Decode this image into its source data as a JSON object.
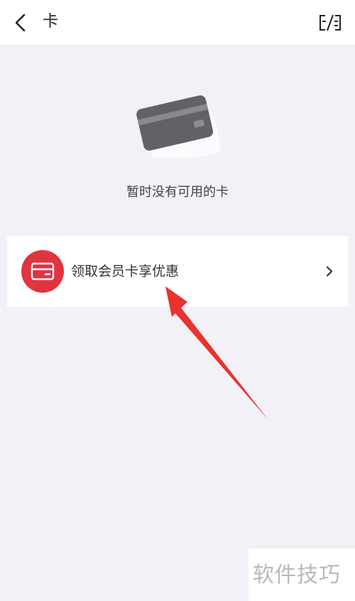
{
  "header": {
    "title": "卡",
    "back_icon": "chevron-left-icon",
    "scan_icon": "scan-card-icon"
  },
  "empty_state": {
    "illustration": "card-icon",
    "message": "暂时没有可用的卡"
  },
  "promo": {
    "label": "领取会员卡享优惠",
    "icon": "card-icon",
    "icon_color": "#e0343f",
    "chevron": "chevron-right-icon"
  },
  "annotation": {
    "arrow_color": "#e8332e"
  },
  "watermark": {
    "text": "软件技巧"
  },
  "colors": {
    "background": "#f2f1f7",
    "surface": "#ffffff",
    "accent": "#e0343f"
  }
}
